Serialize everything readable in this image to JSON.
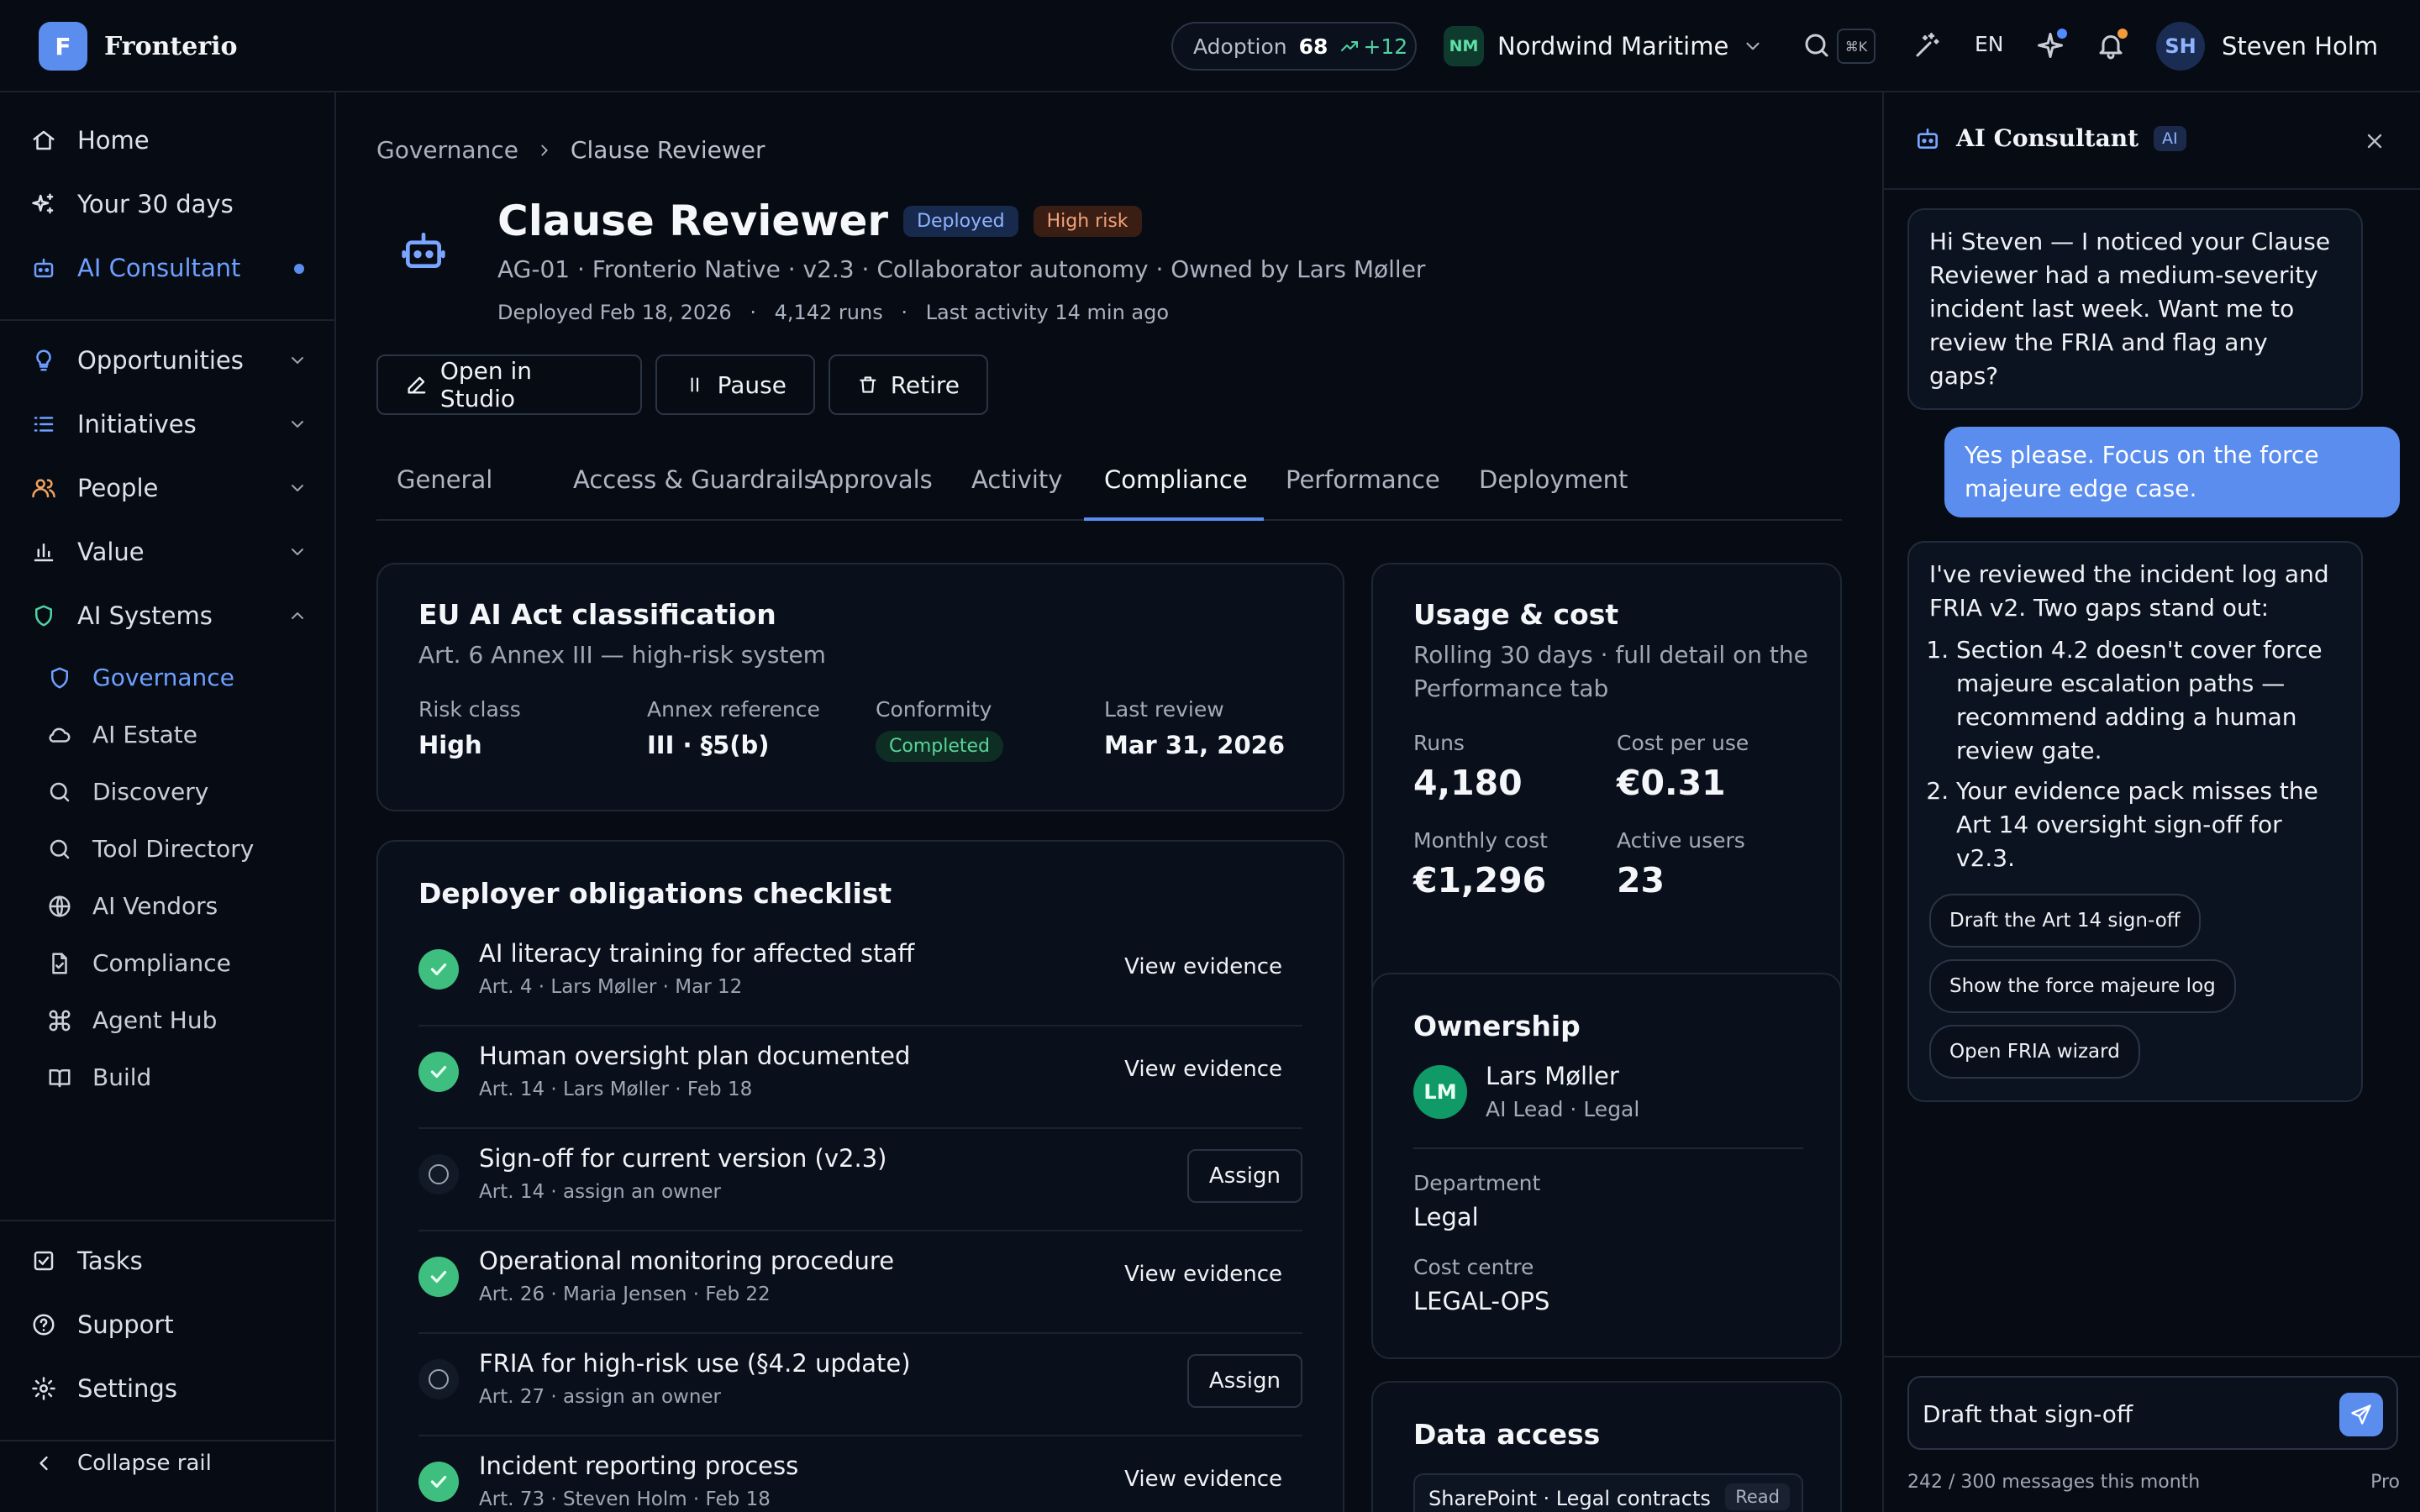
{
  "brand": {
    "logo_letter": "F",
    "name": "Fronterio"
  },
  "header": {
    "adoption_label": "Adoption",
    "adoption_value": "68",
    "adoption_delta": "+12",
    "org_initials": "NM",
    "org_name": "Nordwind Maritime",
    "shortcut": "⌘K",
    "language": "EN",
    "user_initials": "SH",
    "user_name": "Steven Holm"
  },
  "rail": {
    "top_items": [
      {
        "label": "Home",
        "icon": "home-icon"
      },
      {
        "label": "Your 30 days",
        "icon": "sparkles-icon"
      },
      {
        "label": "AI Consultant",
        "icon": "robot-icon"
      }
    ],
    "groups": [
      {
        "label": "Opportunities",
        "icon": "lightbulb-icon"
      },
      {
        "label": "Initiatives",
        "icon": "list-icon"
      },
      {
        "label": "People",
        "icon": "people-icon"
      },
      {
        "label": "Value",
        "icon": "bar-chart-icon"
      },
      {
        "label": "AI Systems",
        "icon": "shield-icon"
      }
    ],
    "sub_items": [
      {
        "label": "Governance",
        "icon": "shield-icon"
      },
      {
        "label": "AI Estate",
        "icon": "cloud-icon"
      },
      {
        "label": "Discovery",
        "icon": "search-icon"
      },
      {
        "label": "Tool Directory",
        "icon": "search-icon"
      },
      {
        "label": "AI Vendors",
        "icon": "globe-icon"
      },
      {
        "label": "Compliance",
        "icon": "file-check-icon"
      },
      {
        "label": "Agent Hub",
        "icon": "command-icon"
      },
      {
        "label": "Build",
        "icon": "book-icon"
      }
    ],
    "bottom_items": [
      {
        "label": "Tasks",
        "icon": "checkbox-icon"
      },
      {
        "label": "Support",
        "icon": "help-icon"
      },
      {
        "label": "Settings",
        "icon": "gear-icon"
      }
    ],
    "collapse_label": "Collapse rail"
  },
  "breadcrumb": {
    "parent": "Governance",
    "current": "Clause Reviewer"
  },
  "agent": {
    "title": "Clause Reviewer",
    "badge_status": "Deployed",
    "badge_risk": "High risk",
    "subline": "AG-01 · Fronterio Native · v2.3 · Collaborator autonomy · Owned by Lars Møller",
    "deployed": "Deployed Feb 18, 2026",
    "runs": "4,142 runs",
    "last_activity": "Last activity 14 min ago"
  },
  "actions": {
    "open_studio": "Open in Studio",
    "pause": "Pause",
    "retire": "Retire"
  },
  "tabs": [
    "General",
    "Access & Guardrails",
    "Approvals",
    "Activity",
    "Compliance",
    "Performance",
    "Deployment"
  ],
  "classification": {
    "title": "EU AI Act classification",
    "subtitle": "Art. 6 Annex III — high-risk system",
    "risk_label": "Risk class",
    "risk_value": "High",
    "annex_label": "Annex reference",
    "annex_value": "III · §5(b)",
    "conformity_label": "Conformity",
    "conformity_value": "Completed",
    "review_label": "Last review",
    "review_value": "Mar 31, 2026"
  },
  "checklist": {
    "title": "Deployer obligations checklist",
    "items": [
      {
        "title": "AI literacy training for affected staff",
        "meta": "Art. 4 · Lars Møller · Mar 12",
        "action": "View evidence"
      },
      {
        "title": "Human oversight plan documented",
        "meta": "Art. 14 · Lars Møller · Feb 18",
        "action": "View evidence"
      },
      {
        "title": "Sign-off for current version (v2.3)",
        "meta": "Art. 14 · assign an owner",
        "action": "Assign"
      },
      {
        "title": "Operational monitoring procedure",
        "meta": "Art. 26 · Maria Jensen · Feb 22",
        "action": "View evidence"
      },
      {
        "title": "FRIA for high-risk use (§4.2 update)",
        "meta": "Art. 27 · assign an owner",
        "action": "Assign"
      },
      {
        "title": "Incident reporting process",
        "meta": "Art. 73 · Steven Holm · Feb 18",
        "action": "View evidence"
      }
    ]
  },
  "usage": {
    "title": "Usage & cost",
    "subtitle": "Rolling 30 days · full detail on the Performance tab",
    "runs_label": "Runs",
    "runs_value": "4,180",
    "cpu_label": "Cost per use",
    "cpu_value": "€0.31",
    "monthly_label": "Monthly cost",
    "monthly_value": "€1,296",
    "users_label": "Active users",
    "users_value": "23"
  },
  "ownership": {
    "title": "Ownership",
    "owner_initials": "LM",
    "owner_name": "Lars Møller",
    "owner_role": "AI Lead · Legal",
    "dept_label": "Department",
    "dept_value": "Legal",
    "cc_label": "Cost centre",
    "cc_value": "LEGAL-OPS"
  },
  "data_access": {
    "title": "Data access",
    "source": "SharePoint · Legal contracts",
    "perm": "Read"
  },
  "consultant": {
    "title": "AI Consultant",
    "tag": "AI",
    "msg1": "Hi Steven — I noticed your Clause Reviewer had a medium-severity incident last week. Want me to review the FRIA and flag any gaps?",
    "msg_user": "Yes please. Focus on the force majeure edge case.",
    "msg2_intro": "I've reviewed the incident log and FRIA v2. Two gaps stand out:",
    "msg2_points": [
      "Section 4.2 doesn't cover force majeure escalation paths — recommend adding a human review gate.",
      "Your evidence pack misses the Art 14 oversight sign-off for v2.3."
    ],
    "chips": [
      "Draft the Art 14 sign-off",
      "Show the force majeure log",
      "Open FRIA wizard"
    ],
    "input_value": "Draft that sign-off",
    "quota": "242 / 300 messages this month",
    "plan": "Pro"
  }
}
